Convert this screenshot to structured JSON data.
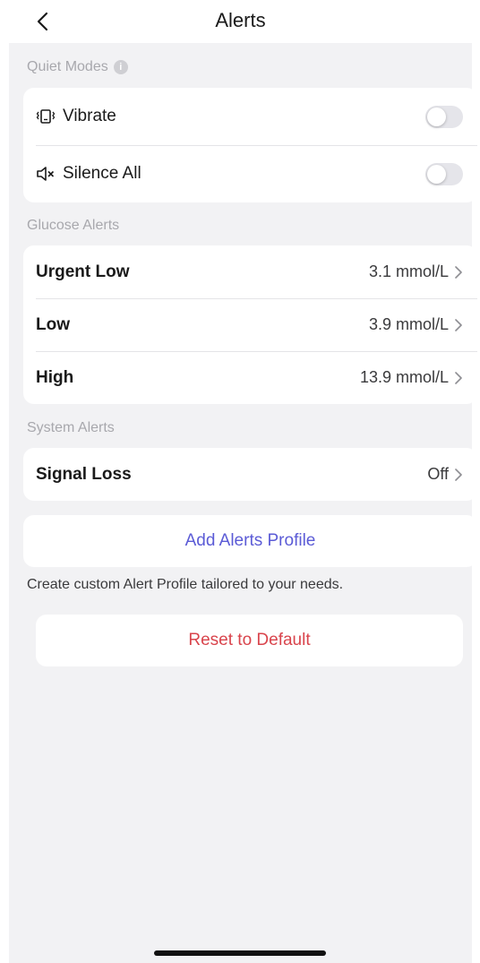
{
  "header": {
    "title": "Alerts",
    "back_icon": "chevron-left-icon"
  },
  "quiet_modes": {
    "label": "Quiet Modes",
    "info_icon": "i",
    "items": [
      {
        "label": "Vibrate",
        "icon": "vibrate-icon",
        "enabled": false
      },
      {
        "label": "Silence All",
        "icon": "speaker-mute-icon",
        "enabled": false
      }
    ]
  },
  "glucose_alerts": {
    "label": "Glucose Alerts",
    "items": [
      {
        "label": "Urgent Low",
        "value": "3.1 mmol/L"
      },
      {
        "label": "Low",
        "value": "3.9 mmol/L"
      },
      {
        "label": "High",
        "value": "13.9 mmol/L"
      }
    ]
  },
  "system_alerts": {
    "label": "System Alerts",
    "items": [
      {
        "label": "Signal Loss",
        "value": "Off"
      }
    ]
  },
  "actions": {
    "add_profile": "Add Alerts Profile",
    "hint": "Create custom Alert Profile tailored to your needs.",
    "reset": "Reset to Default"
  },
  "colors": {
    "accent": "#5b5bd6",
    "danger": "#d9444c",
    "background": "#f2f2f4",
    "toggle_off": "#e5e5ea"
  }
}
